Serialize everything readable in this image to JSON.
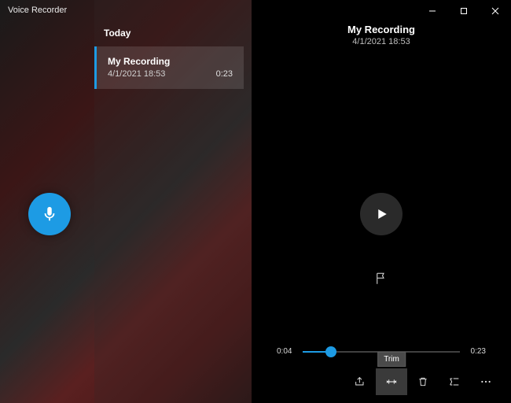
{
  "app": {
    "title": "Voice Recorder"
  },
  "list": {
    "header": "Today",
    "items": [
      {
        "title": "My Recording",
        "date": "4/1/2021 18:53",
        "duration": "0:23"
      }
    ]
  },
  "detail": {
    "title": "My Recording",
    "date": "4/1/2021 18:53",
    "pos": "0:04",
    "dur": "0:23"
  },
  "toolbar": {
    "share_label": "Share",
    "trim_label": "Trim",
    "delete_label": "Delete",
    "rename_label": "Rename",
    "more_label": "More"
  },
  "colors": {
    "accent": "#1d9be4",
    "annotation": "#f5a623"
  }
}
